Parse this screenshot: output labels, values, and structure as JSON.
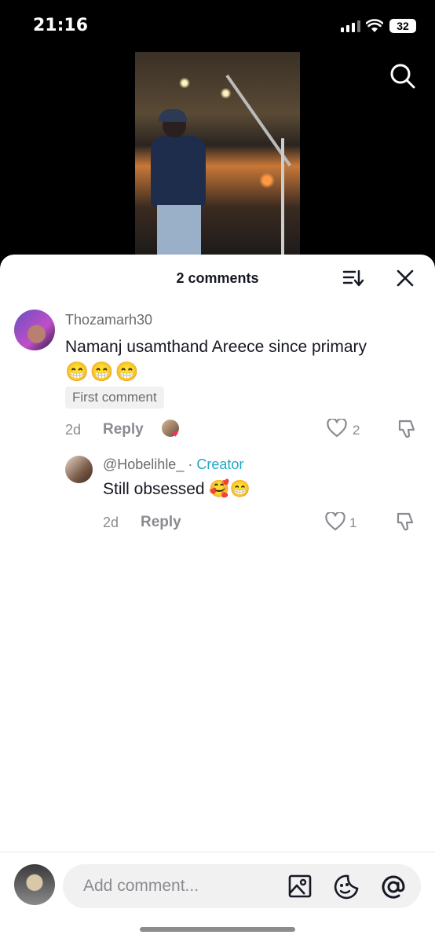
{
  "status_bar": {
    "time": "21:16",
    "battery": "32"
  },
  "sheet": {
    "count_label": "2 comments",
    "comments": [
      {
        "username": "Thozamarh30",
        "text": "Namanj usamthand Areece since primary",
        "emojis": "😁😁😁",
        "badge": "First comment",
        "time": "2d",
        "reply_label": "Reply",
        "likes": "2"
      },
      {
        "username": "@Hobelihle_",
        "separator": " · ",
        "role": "Creator",
        "text": "Still obsessed 🥰😁",
        "time": "2d",
        "reply_label": "Reply",
        "likes": "1"
      }
    ]
  },
  "composer": {
    "placeholder": "Add comment..."
  },
  "icons": [
    "search-icon",
    "sort-icon",
    "close-icon",
    "heart-icon",
    "dislike-icon",
    "image-icon",
    "emoji-icon",
    "mention-icon"
  ]
}
